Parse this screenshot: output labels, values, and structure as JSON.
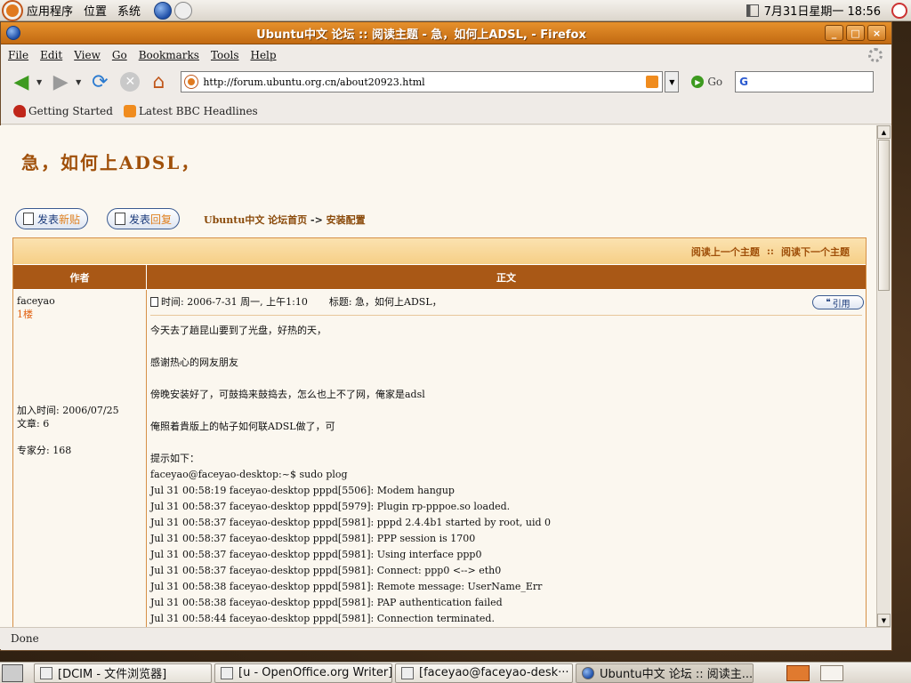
{
  "top_panel": {
    "menus": [
      "应用程序",
      "位置",
      "系统"
    ],
    "clock": "7月31日星期一 18:56"
  },
  "window": {
    "title": "Ubuntu中文 论坛 :: 阅读主题 - 急，如何上ADSL, - Firefox",
    "controls": {
      "minimize": "_",
      "maximize": "□",
      "close": "×"
    }
  },
  "menubar": [
    "File",
    "Edit",
    "View",
    "Go",
    "Bookmarks",
    "Tools",
    "Help"
  ],
  "navbar": {
    "url": "http://forum.ubuntu.org.cn/about20923.html",
    "go_label": "Go",
    "search_engine_letter": "G"
  },
  "bookmarks": [
    "Getting Started",
    "Latest BBC Headlines"
  ],
  "page": {
    "topic_title": "急，如何上ADSL，",
    "new_topic": {
      "a": "发表",
      "b": "新贴"
    },
    "reply": {
      "a": "发表",
      "b": "回复"
    },
    "breadcrumb": {
      "a": "Ubuntu中文 论坛首页",
      "sep": "->",
      "b": "安装配置"
    },
    "topic_nav": {
      "prev": "阅读上一个主题",
      "sep": "::",
      "next": "阅读下一个主题"
    },
    "headers": {
      "author": "作者",
      "body": "正文"
    },
    "post": {
      "author": "faceyao",
      "floor": "1楼",
      "joined": "加入时间: 2006/07/25",
      "posts": "文章: 6",
      "score": "专家分: 168",
      "time": "时间: 2006-7-31 周一, 上午1:10",
      "subject": "标题: 急，如何上ADSL，",
      "quote_label": "引用",
      "paragraphs": [
        "今天去了趟昆山要到了光盘，好热的天，",
        "感谢热心的网友朋友",
        "傍晚安装好了，可鼓捣来鼓捣去，怎么也上不了网，俺家是adsl",
        "俺照着貴版上的帖子如何联ADSL做了，可"
      ],
      "log_intro": "提示如下：",
      "log_lines": [
        "faceyao@faceyao-desktop:~$ sudo plog",
        "Jul 31 00:58:19 faceyao-desktop pppd[5506]: Modem hangup",
        "Jul 31 00:58:37 faceyao-desktop pppd[5979]: Plugin rp-pppoe.so loaded.",
        "Jul 31 00:58:37 faceyao-desktop pppd[5981]: pppd 2.4.4b1 started by root, uid 0",
        "Jul 31 00:58:37 faceyao-desktop pppd[5981]: PPP session is 1700",
        "Jul 31 00:58:37 faceyao-desktop pppd[5981]: Using interface ppp0",
        "Jul 31 00:58:37 faceyao-desktop pppd[5981]: Connect: ppp0 <--> eth0",
        "Jul 31 00:58:38 faceyao-desktop pppd[5981]: Remote message: UserName_Err",
        "Jul 31 00:58:38 faceyao-desktop pppd[5981]: PAP authentication failed",
        "Jul 31 00:58:44 faceyao-desktop pppd[5981]: Connection terminated."
      ]
    }
  },
  "status": "Done",
  "taskbar": [
    "[DCIM - 文件浏览器]",
    "[u - OpenOffice.org Writer]",
    "[faceyao@faceyao-desk···",
    "Ubuntu中文 论坛 :: 阅读主..."
  ],
  "colors": {
    "accent": "#a95816",
    "title": "#a0500a",
    "titlebar": "#d27d22"
  }
}
